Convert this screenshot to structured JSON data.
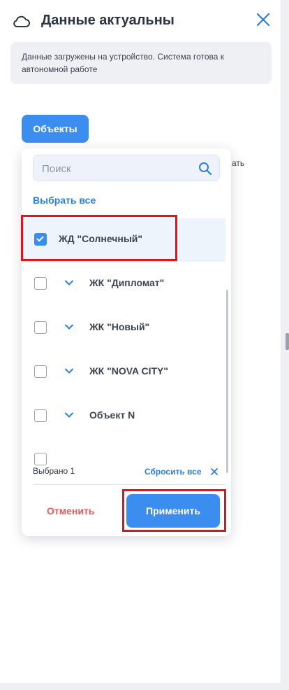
{
  "header": {
    "title": "Данные актуальны",
    "icon": "cloud-icon",
    "close_icon": "close-icon"
  },
  "notice": {
    "text": "Данные загружены на устройство. Система готова к автономной работе"
  },
  "objects_button": {
    "label": "Объекты"
  },
  "partial_text": "ать",
  "dropdown": {
    "search": {
      "placeholder": "Поиск",
      "value": ""
    },
    "select_all": "Выбрать все",
    "items": [
      {
        "label": "ЖД \"Солнечный\"",
        "checked": true,
        "expandable": false
      },
      {
        "label": "ЖК \"Дипломат\"",
        "checked": false,
        "expandable": true
      },
      {
        "label": "ЖК \"Новый\"",
        "checked": false,
        "expandable": true
      },
      {
        "label": "ЖК \"NOVA CITY\"",
        "checked": false,
        "expandable": true
      },
      {
        "label": "Объект N",
        "checked": false,
        "expandable": true
      }
    ],
    "footer": {
      "selected_count": "Выбрано 1",
      "reset_label": "Сбросить все"
    },
    "cancel_label": "Отменить",
    "apply_label": "Применить"
  },
  "colors": {
    "accent": "#3b8ef0",
    "link": "#2f7fd6",
    "danger": "#e5595e",
    "highlight": "#e0141b"
  }
}
